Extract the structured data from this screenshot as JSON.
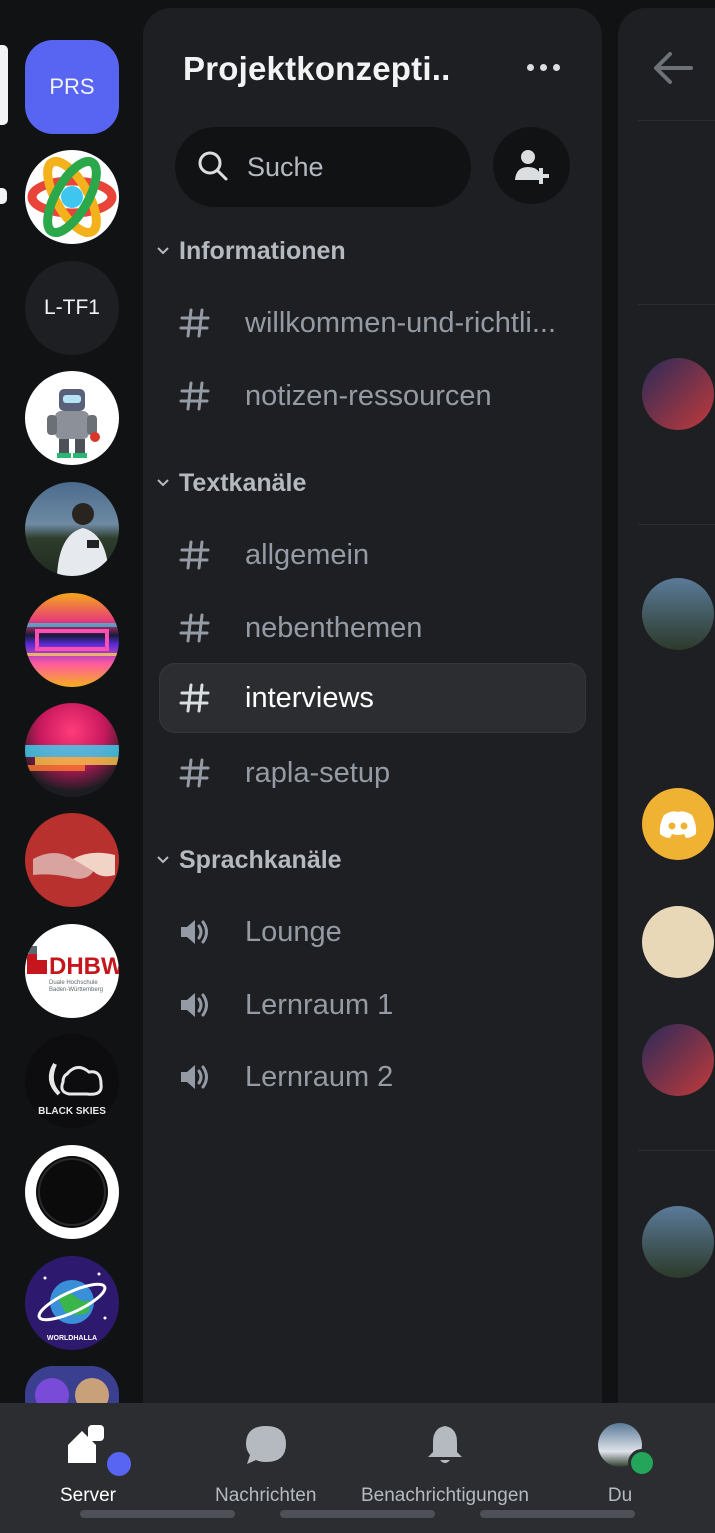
{
  "servers": {
    "items": [
      {
        "label": "PRS",
        "bg": "#5865f2",
        "kind": "text-square"
      },
      {
        "label": "",
        "kind": "atom-icon"
      },
      {
        "label": "L-TF1",
        "bg": "#1e1f22",
        "kind": "text-circle"
      },
      {
        "label": "",
        "kind": "robot-avatar"
      },
      {
        "label": "",
        "kind": "photo-person"
      },
      {
        "label": "",
        "kind": "glitch-art"
      },
      {
        "label": "",
        "kind": "color-burst"
      },
      {
        "label": "",
        "kind": "handshake"
      },
      {
        "label": "DHBW",
        "sublabel": "Duale Hochschule Baden-Württemberg",
        "kind": "dhbw-logo"
      },
      {
        "label": "BLACK SKIES",
        "kind": "black-skies-logo"
      },
      {
        "label": "",
        "kind": "ring"
      },
      {
        "label": "WORLDHALLA",
        "kind": "worldhalla-logo"
      },
      {
        "label": "",
        "kind": "folder"
      }
    ]
  },
  "panel": {
    "guild_name": "Projektkonzepti..",
    "search_placeholder": "Suche",
    "categories": [
      {
        "name": "Informationen",
        "channels": [
          {
            "name": "willkommen-und-richtli...",
            "type": "text"
          },
          {
            "name": "notizen-ressourcen",
            "type": "text"
          }
        ]
      },
      {
        "name": "Textkanäle",
        "channels": [
          {
            "name": "allgemein",
            "type": "text"
          },
          {
            "name": "nebenthemen",
            "type": "text"
          },
          {
            "name": "interviews",
            "type": "text",
            "active": true
          },
          {
            "name": "rapla-setup",
            "type": "text"
          }
        ]
      },
      {
        "name": "Sprachkanäle",
        "channels": [
          {
            "name": "Lounge",
            "type": "voice"
          },
          {
            "name": "Lernraum 1",
            "type": "voice"
          },
          {
            "name": "Lernraum 2",
            "type": "voice"
          }
        ]
      }
    ]
  },
  "bottom_nav": {
    "server": "Server",
    "messages": "Nachrichten",
    "notifications": "Benachrichtigungen",
    "you": "Du"
  },
  "colors": {
    "blurple": "#5865f2",
    "online": "#23a55a",
    "discord_badge": "#f0b232"
  }
}
